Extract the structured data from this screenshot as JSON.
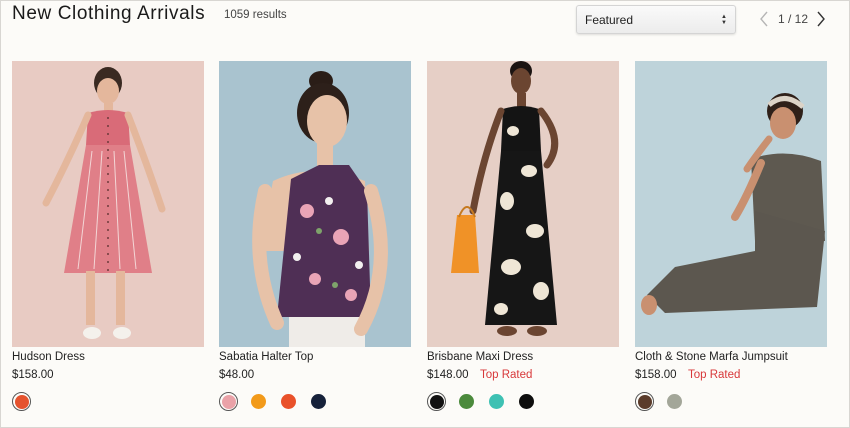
{
  "header": {
    "title": "New Clothing Arrivals",
    "result_count": "1059 results",
    "sort": {
      "selected": "Featured"
    },
    "pagination": {
      "indicator": "1 / 12"
    }
  },
  "products": [
    {
      "name": "Hudson Dress",
      "price": "$158.00",
      "badge": "",
      "background": "#e8cbc3",
      "swatches": [
        "#e5532e"
      ],
      "selected_swatch": 0
    },
    {
      "name": "Sabatia Halter Top",
      "price": "$48.00",
      "badge": "",
      "background": "#a9c3cf",
      "swatches": [
        "#eaa2a8",
        "#f29a1a",
        "#e9512a",
        "#16213a"
      ],
      "selected_swatch": 0
    },
    {
      "name": "Brisbane Maxi Dress",
      "price": "$148.00",
      "badge": "Top Rated",
      "background": "#e6cfc6",
      "swatches": [
        "#111111",
        "#4b8a3c",
        "#3ec1b3",
        "#0e0e0e"
      ],
      "selected_swatch": 0
    },
    {
      "name": "Cloth & Stone Marfa Jumpsuit",
      "price": "$158.00",
      "badge": "Top Rated",
      "background": "#bed3da",
      "swatches": [
        "#5b3b2a",
        "#a3a699"
      ],
      "selected_swatch": 0
    }
  ]
}
